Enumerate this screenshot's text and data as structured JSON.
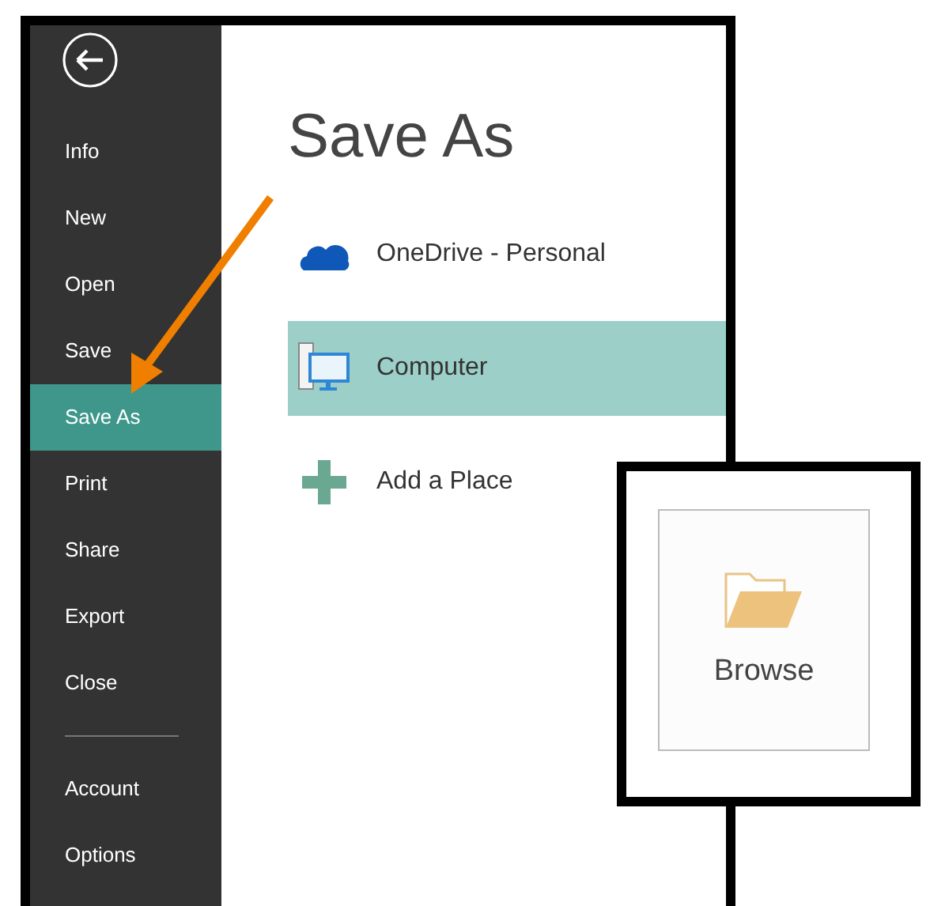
{
  "sidebar": {
    "items": [
      {
        "label": "Info",
        "selected": false
      },
      {
        "label": "New",
        "selected": false
      },
      {
        "label": "Open",
        "selected": false
      },
      {
        "label": "Save",
        "selected": false
      },
      {
        "label": "Save As",
        "selected": true
      },
      {
        "label": "Print",
        "selected": false
      },
      {
        "label": "Share",
        "selected": false
      },
      {
        "label": "Export",
        "selected": false
      },
      {
        "label": "Close",
        "selected": false
      }
    ],
    "bottom_items": [
      {
        "label": "Account",
        "selected": false
      },
      {
        "label": "Options",
        "selected": false
      }
    ]
  },
  "title": "Save As",
  "places": [
    {
      "kind": "cloud",
      "label": "OneDrive - Personal",
      "selected": false
    },
    {
      "kind": "computer",
      "label": "Computer",
      "selected": true
    },
    {
      "kind": "add",
      "label": "Add a Place",
      "selected": false
    }
  ],
  "browse": {
    "label": "Browse"
  }
}
